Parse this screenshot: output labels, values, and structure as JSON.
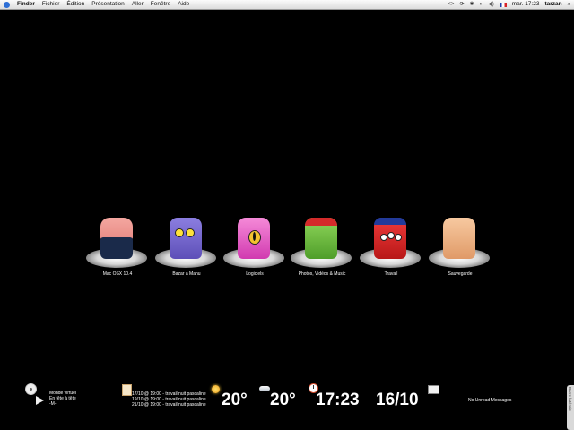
{
  "menubar": {
    "items": [
      "Finder",
      "Fichier",
      "Édition",
      "Présentation",
      "Aller",
      "Fenêtre",
      "Aide"
    ],
    "clock": "mar. 17:23",
    "user": "tarzan"
  },
  "desktop_icons": [
    {
      "label": "Mac OSX 10.4"
    },
    {
      "label": "Bazar a Manu"
    },
    {
      "label": "Logiciels"
    },
    {
      "label": "Photos, Vidéos & Music"
    },
    {
      "label": "Travail"
    },
    {
      "label": "Sauvegarde"
    }
  ],
  "itunes": {
    "line1": "Monde virtuel",
    "line2": "En tête à tête",
    "line3": "-M-"
  },
  "calendar": {
    "events": [
      "17/10 @ 19:00 - travail nuit pascaline",
      "19/10 @ 19:00 - travail nuit pascaline",
      "21/10 @ 19:00 - travail nuit pascaline"
    ]
  },
  "weather": {
    "temp1": "20°",
    "temp2": "20°"
  },
  "time": "17:23",
  "date": "16/10",
  "mail": {
    "status": "No Unread Messages"
  },
  "side_tab": "Barre latérale"
}
